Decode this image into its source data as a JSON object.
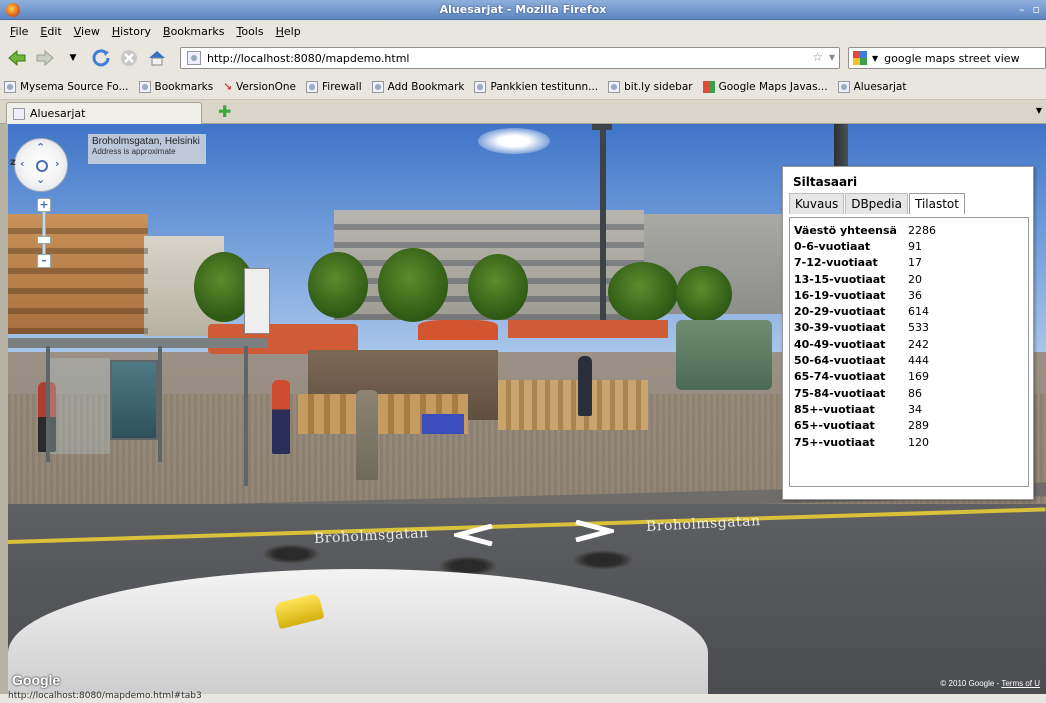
{
  "window": {
    "title": "Aluesarjat - Mozilla Firefox"
  },
  "menu": [
    "File",
    "Edit",
    "View",
    "History",
    "Bookmarks",
    "Tools",
    "Help"
  ],
  "navigation": {
    "url": "http://localhost:8080/mapdemo.html",
    "search_value": "google maps street view"
  },
  "bookmarks": [
    "Mysema Source Fo...",
    "Bookmarks",
    "VersionOne",
    "Firewall",
    "Add Bookmark",
    "Pankkien testitunn...",
    "bit.ly sidebar",
    "Google Maps Javas...",
    "Aluesarjat"
  ],
  "tabs": [
    {
      "label": "Aluesarjat"
    }
  ],
  "streetview": {
    "address_main": "Broholmsgatan, Helsinki",
    "address_sub": "Address is approximate",
    "road_label_left": "Broholmsgatan",
    "road_label_right": "Broholmsgatan",
    "google_logo": "Google",
    "copyright": "© 2010 Google - ",
    "terms": "Terms of U",
    "compass_z": "z"
  },
  "infowindow": {
    "title": "Siltasaari",
    "tabs": [
      "Kuvaus",
      "DBpedia",
      "Tilastot"
    ],
    "active_tab": "Tilastot",
    "stats": [
      {
        "label": "Väestö yhteensä",
        "value": "2286"
      },
      {
        "label": "0-6-vuotiaat",
        "value": "91"
      },
      {
        "label": "7-12-vuotiaat",
        "value": "17"
      },
      {
        "label": "13-15-vuotiaat",
        "value": "20"
      },
      {
        "label": "16-19-vuotiaat",
        "value": "36"
      },
      {
        "label": "20-29-vuotiaat",
        "value": "614"
      },
      {
        "label": "30-39-vuotiaat",
        "value": "533"
      },
      {
        "label": "40-49-vuotiaat",
        "value": "242"
      },
      {
        "label": "50-64-vuotiaat",
        "value": "444"
      },
      {
        "label": "65-74-vuotiaat",
        "value": "169"
      },
      {
        "label": "75-84-vuotiaat",
        "value": "86"
      },
      {
        "label": "85+-vuotiaat",
        "value": "34"
      },
      {
        "label": "65+-vuotiaat",
        "value": "289"
      },
      {
        "label": "75+-vuotiaat",
        "value": "120"
      }
    ]
  },
  "statusbar": {
    "text": "http://localhost:8080/mapdemo.html#tab3"
  }
}
